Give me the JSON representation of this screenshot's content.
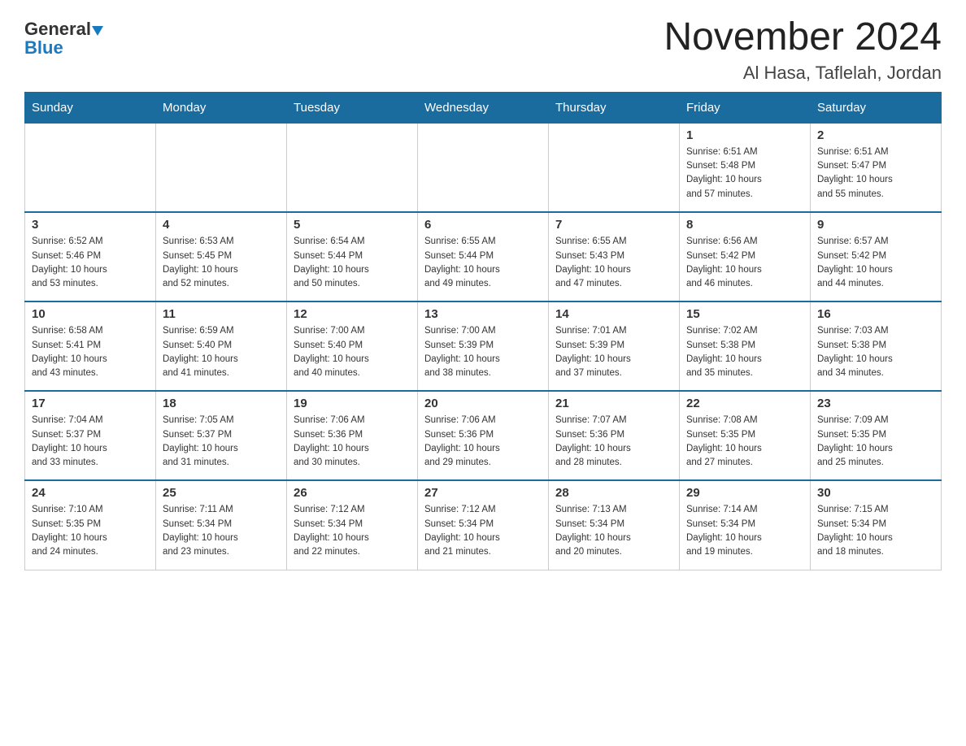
{
  "header": {
    "logo": {
      "general": "General",
      "blue": "Blue"
    },
    "title": "November 2024",
    "location": "Al Hasa, Taflelah, Jordan"
  },
  "calendar": {
    "days_of_week": [
      "Sunday",
      "Monday",
      "Tuesday",
      "Wednesday",
      "Thursday",
      "Friday",
      "Saturday"
    ],
    "weeks": [
      [
        {
          "day": "",
          "info": ""
        },
        {
          "day": "",
          "info": ""
        },
        {
          "day": "",
          "info": ""
        },
        {
          "day": "",
          "info": ""
        },
        {
          "day": "",
          "info": ""
        },
        {
          "day": "1",
          "info": "Sunrise: 6:51 AM\nSunset: 5:48 PM\nDaylight: 10 hours\nand 57 minutes."
        },
        {
          "day": "2",
          "info": "Sunrise: 6:51 AM\nSunset: 5:47 PM\nDaylight: 10 hours\nand 55 minutes."
        }
      ],
      [
        {
          "day": "3",
          "info": "Sunrise: 6:52 AM\nSunset: 5:46 PM\nDaylight: 10 hours\nand 53 minutes."
        },
        {
          "day": "4",
          "info": "Sunrise: 6:53 AM\nSunset: 5:45 PM\nDaylight: 10 hours\nand 52 minutes."
        },
        {
          "day": "5",
          "info": "Sunrise: 6:54 AM\nSunset: 5:44 PM\nDaylight: 10 hours\nand 50 minutes."
        },
        {
          "day": "6",
          "info": "Sunrise: 6:55 AM\nSunset: 5:44 PM\nDaylight: 10 hours\nand 49 minutes."
        },
        {
          "day": "7",
          "info": "Sunrise: 6:55 AM\nSunset: 5:43 PM\nDaylight: 10 hours\nand 47 minutes."
        },
        {
          "day": "8",
          "info": "Sunrise: 6:56 AM\nSunset: 5:42 PM\nDaylight: 10 hours\nand 46 minutes."
        },
        {
          "day": "9",
          "info": "Sunrise: 6:57 AM\nSunset: 5:42 PM\nDaylight: 10 hours\nand 44 minutes."
        }
      ],
      [
        {
          "day": "10",
          "info": "Sunrise: 6:58 AM\nSunset: 5:41 PM\nDaylight: 10 hours\nand 43 minutes."
        },
        {
          "day": "11",
          "info": "Sunrise: 6:59 AM\nSunset: 5:40 PM\nDaylight: 10 hours\nand 41 minutes."
        },
        {
          "day": "12",
          "info": "Sunrise: 7:00 AM\nSunset: 5:40 PM\nDaylight: 10 hours\nand 40 minutes."
        },
        {
          "day": "13",
          "info": "Sunrise: 7:00 AM\nSunset: 5:39 PM\nDaylight: 10 hours\nand 38 minutes."
        },
        {
          "day": "14",
          "info": "Sunrise: 7:01 AM\nSunset: 5:39 PM\nDaylight: 10 hours\nand 37 minutes."
        },
        {
          "day": "15",
          "info": "Sunrise: 7:02 AM\nSunset: 5:38 PM\nDaylight: 10 hours\nand 35 minutes."
        },
        {
          "day": "16",
          "info": "Sunrise: 7:03 AM\nSunset: 5:38 PM\nDaylight: 10 hours\nand 34 minutes."
        }
      ],
      [
        {
          "day": "17",
          "info": "Sunrise: 7:04 AM\nSunset: 5:37 PM\nDaylight: 10 hours\nand 33 minutes."
        },
        {
          "day": "18",
          "info": "Sunrise: 7:05 AM\nSunset: 5:37 PM\nDaylight: 10 hours\nand 31 minutes."
        },
        {
          "day": "19",
          "info": "Sunrise: 7:06 AM\nSunset: 5:36 PM\nDaylight: 10 hours\nand 30 minutes."
        },
        {
          "day": "20",
          "info": "Sunrise: 7:06 AM\nSunset: 5:36 PM\nDaylight: 10 hours\nand 29 minutes."
        },
        {
          "day": "21",
          "info": "Sunrise: 7:07 AM\nSunset: 5:36 PM\nDaylight: 10 hours\nand 28 minutes."
        },
        {
          "day": "22",
          "info": "Sunrise: 7:08 AM\nSunset: 5:35 PM\nDaylight: 10 hours\nand 27 minutes."
        },
        {
          "day": "23",
          "info": "Sunrise: 7:09 AM\nSunset: 5:35 PM\nDaylight: 10 hours\nand 25 minutes."
        }
      ],
      [
        {
          "day": "24",
          "info": "Sunrise: 7:10 AM\nSunset: 5:35 PM\nDaylight: 10 hours\nand 24 minutes."
        },
        {
          "day": "25",
          "info": "Sunrise: 7:11 AM\nSunset: 5:34 PM\nDaylight: 10 hours\nand 23 minutes."
        },
        {
          "day": "26",
          "info": "Sunrise: 7:12 AM\nSunset: 5:34 PM\nDaylight: 10 hours\nand 22 minutes."
        },
        {
          "day": "27",
          "info": "Sunrise: 7:12 AM\nSunset: 5:34 PM\nDaylight: 10 hours\nand 21 minutes."
        },
        {
          "day": "28",
          "info": "Sunrise: 7:13 AM\nSunset: 5:34 PM\nDaylight: 10 hours\nand 20 minutes."
        },
        {
          "day": "29",
          "info": "Sunrise: 7:14 AM\nSunset: 5:34 PM\nDaylight: 10 hours\nand 19 minutes."
        },
        {
          "day": "30",
          "info": "Sunrise: 7:15 AM\nSunset: 5:34 PM\nDaylight: 10 hours\nand 18 minutes."
        }
      ]
    ]
  }
}
